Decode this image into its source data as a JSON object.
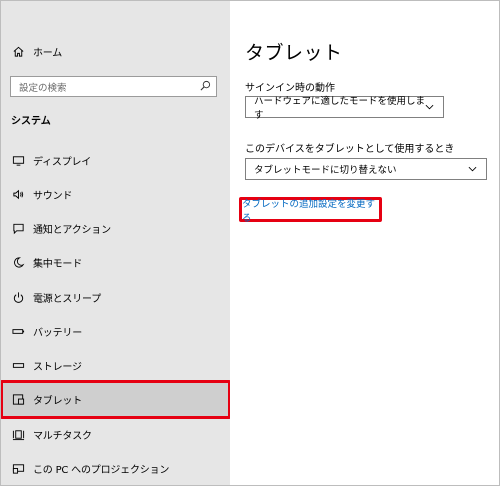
{
  "sidebar": {
    "home_label": "ホーム",
    "search_placeholder": "設定の検索",
    "section_title": "システム",
    "items": [
      {
        "label": "ディスプレイ",
        "icon": "monitor-icon"
      },
      {
        "label": "サウンド",
        "icon": "speaker-icon"
      },
      {
        "label": "通知とアクション",
        "icon": "notification-icon"
      },
      {
        "label": "集中モード",
        "icon": "moon-icon"
      },
      {
        "label": "電源とスリープ",
        "icon": "power-icon"
      },
      {
        "label": "バッテリー",
        "icon": "battery-icon"
      },
      {
        "label": "ストレージ",
        "icon": "storage-icon"
      },
      {
        "label": "タブレット",
        "icon": "tablet-icon",
        "selected": true
      },
      {
        "label": "マルチタスク",
        "icon": "multitask-icon"
      },
      {
        "label": "この PC へのプロジェクション",
        "icon": "projection-icon"
      }
    ]
  },
  "main": {
    "title": "タブレット",
    "signin_label": "サインイン時の動作",
    "signin_value": "ハードウェアに適したモードを使用します",
    "device_label": "このデバイスをタブレットとして使用するとき",
    "device_value": "タブレットモードに切り替えない",
    "link": "タブレットの追加設定を変更する"
  },
  "colors": {
    "highlight": "#e60012",
    "link": "#0067c0",
    "sidebar_bg": "#e6e6e6",
    "selected_bg": "#cfcfcf"
  }
}
